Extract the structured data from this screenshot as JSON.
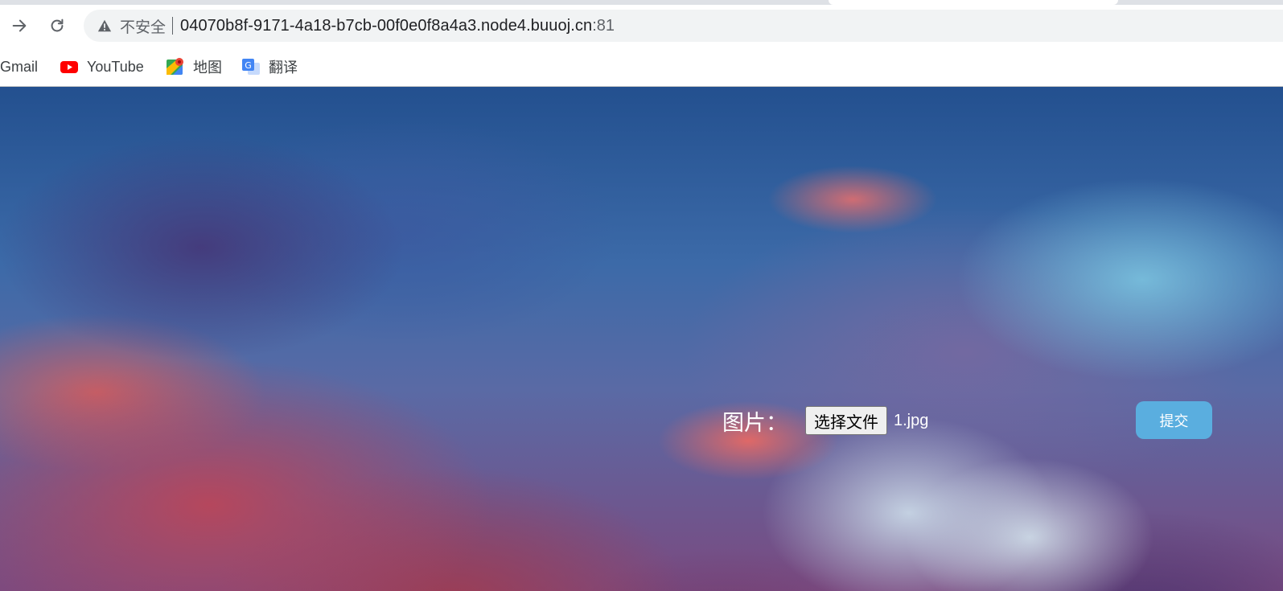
{
  "browser": {
    "security_label": "不安全",
    "url": "04070b8f-9171-4a18-b7cb-00f0e0f8a4a3.node4.buuoj.cn",
    "port": ":81",
    "icons": {
      "forward": "arrow-right-icon",
      "reload": "reload-icon",
      "security": "warning-triangle-icon"
    }
  },
  "bookmarks": [
    {
      "label": "Gmail",
      "icon": "gmail-icon"
    },
    {
      "label": "YouTube",
      "icon": "youtube-icon"
    },
    {
      "label": "地图",
      "icon": "maps-icon"
    },
    {
      "label": "翻译",
      "icon": "translate-icon"
    }
  ],
  "upload_form": {
    "label": "图片：",
    "file_button": "选择文件",
    "file_name": "1.jpg",
    "submit_label": "提交"
  },
  "colors": {
    "submit_button": "#5aaedf",
    "youtube_red": "#ff0000"
  }
}
